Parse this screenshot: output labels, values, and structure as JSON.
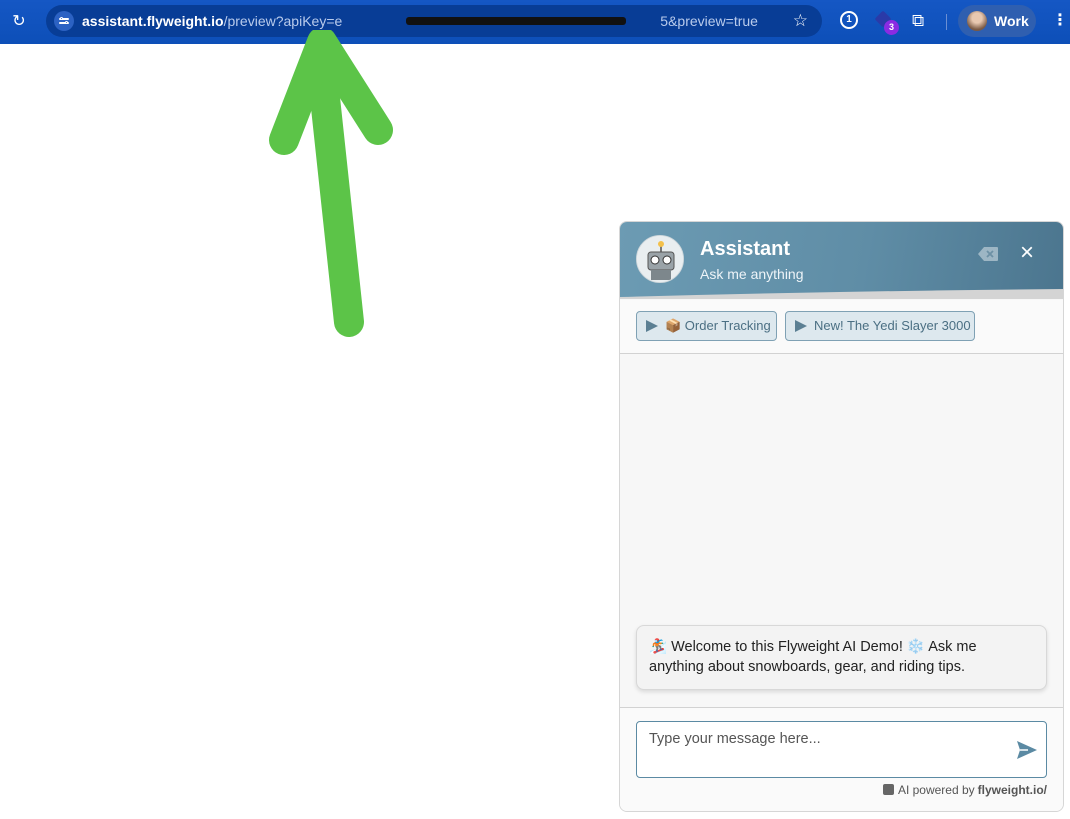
{
  "browser": {
    "url_host": "assistant.flyweight.io",
    "url_path": "/preview?apiKey=e",
    "url_tail": "5&preview=true",
    "extension_badge": "3",
    "password_manager_glyph": "1",
    "profile_label": "Work",
    "icons": [
      "reload-icon",
      "site-settings-icon",
      "bookmark-star-icon",
      "password-manager-icon",
      "extension-icon",
      "puzzle-icon",
      "more-menu-icon"
    ]
  },
  "widget": {
    "title": "Assistant",
    "subtitle": "Ask me anything",
    "header_colors": [
      "#6c9bb3",
      "#4b758e"
    ],
    "chips": [
      {
        "label": "📦 Order Tracking"
      },
      {
        "label": "New! The Yedi Slayer 3000"
      }
    ],
    "welcome_message": "🏂 Welcome to this Flyweight AI Demo! ❄️ Ask me anything about snowboards, gear, and riding tips.",
    "input_placeholder": "Type your message here...",
    "powered_prefix": "AI powered by",
    "powered_brand": "flyweight.io/"
  },
  "annotation": {
    "arrow_color": "#5cc448",
    "arrow_direction": "up"
  }
}
